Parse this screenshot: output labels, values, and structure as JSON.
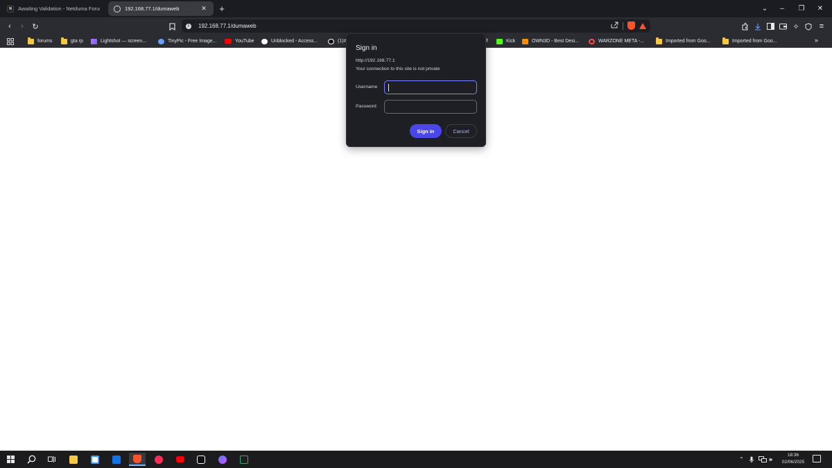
{
  "tabs": [
    {
      "title": "Awaiting Validation - Netduma Forum",
      "favicon": "N"
    },
    {
      "title": "192.168.77.1/dumaweb"
    }
  ],
  "toolbar": {
    "url": "192.168.77.1/dumaweb"
  },
  "bookmarks": [
    {
      "label": "forums",
      "icon": "folder-icon"
    },
    {
      "label": "gta rp",
      "icon": "folder-icon"
    },
    {
      "label": "Lightshot — screen...",
      "icon": "lightshot-icon"
    },
    {
      "label": "TinyPic - Free Image...",
      "icon": "tinypic-icon"
    },
    {
      "label": "YouTube",
      "icon": "youtube-icon"
    },
    {
      "label": "Unblocked - Access...",
      "icon": "unblocked-icon"
    },
    {
      "label": "(1)#",
      "icon": "tiktok-icon"
    },
    {
      "label": "ff",
      "icon": ""
    },
    {
      "label": "Kick",
      "icon": "kick-icon"
    },
    {
      "label": "OWN3D - Best Desi...",
      "icon": "own3d-icon"
    },
    {
      "label": "WARZONE META -...",
      "icon": "warzone-icon"
    },
    {
      "label": "Imported from Goo...",
      "icon": "folder-icon"
    },
    {
      "label": "Imported from Goo...",
      "icon": "folder-icon"
    }
  ],
  "dialog": {
    "title": "Sign in",
    "origin": "http://192.168.77.1",
    "note": "Your connection to this site is not private",
    "username_label": "Username",
    "password_label": "Password",
    "username_value": "",
    "password_value": "",
    "sign_in_label": "Sign in",
    "cancel_label": "Cancel"
  },
  "taskbar": {
    "time": "18:36",
    "date": "02/06/2025"
  },
  "colors": {
    "accent": "#4a46e8",
    "focus_ring": "#7d82ff",
    "brave": "#fb542b"
  }
}
